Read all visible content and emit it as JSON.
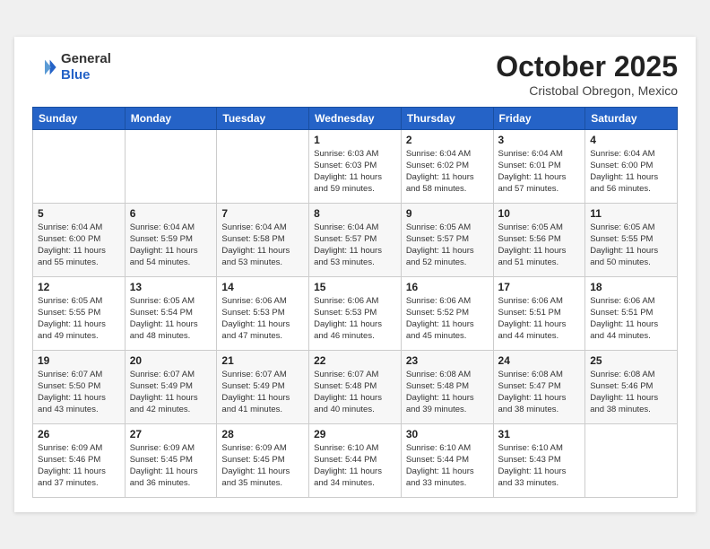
{
  "header": {
    "logo": {
      "general": "General",
      "blue": "Blue"
    },
    "month": "October 2025",
    "location": "Cristobal Obregon, Mexico"
  },
  "weekdays": [
    "Sunday",
    "Monday",
    "Tuesday",
    "Wednesday",
    "Thursday",
    "Friday",
    "Saturday"
  ],
  "weeks": [
    [
      {
        "day": null
      },
      {
        "day": null
      },
      {
        "day": null
      },
      {
        "day": 1,
        "sunrise": "6:03 AM",
        "sunset": "6:03 PM",
        "daylight": "11 hours and 59 minutes."
      },
      {
        "day": 2,
        "sunrise": "6:04 AM",
        "sunset": "6:02 PM",
        "daylight": "11 hours and 58 minutes."
      },
      {
        "day": 3,
        "sunrise": "6:04 AM",
        "sunset": "6:01 PM",
        "daylight": "11 hours and 57 minutes."
      },
      {
        "day": 4,
        "sunrise": "6:04 AM",
        "sunset": "6:00 PM",
        "daylight": "11 hours and 56 minutes."
      }
    ],
    [
      {
        "day": 5,
        "sunrise": "6:04 AM",
        "sunset": "6:00 PM",
        "daylight": "11 hours and 55 minutes."
      },
      {
        "day": 6,
        "sunrise": "6:04 AM",
        "sunset": "5:59 PM",
        "daylight": "11 hours and 54 minutes."
      },
      {
        "day": 7,
        "sunrise": "6:04 AM",
        "sunset": "5:58 PM",
        "daylight": "11 hours and 53 minutes."
      },
      {
        "day": 8,
        "sunrise": "6:04 AM",
        "sunset": "5:57 PM",
        "daylight": "11 hours and 53 minutes."
      },
      {
        "day": 9,
        "sunrise": "6:05 AM",
        "sunset": "5:57 PM",
        "daylight": "11 hours and 52 minutes."
      },
      {
        "day": 10,
        "sunrise": "6:05 AM",
        "sunset": "5:56 PM",
        "daylight": "11 hours and 51 minutes."
      },
      {
        "day": 11,
        "sunrise": "6:05 AM",
        "sunset": "5:55 PM",
        "daylight": "11 hours and 50 minutes."
      }
    ],
    [
      {
        "day": 12,
        "sunrise": "6:05 AM",
        "sunset": "5:55 PM",
        "daylight": "11 hours and 49 minutes."
      },
      {
        "day": 13,
        "sunrise": "6:05 AM",
        "sunset": "5:54 PM",
        "daylight": "11 hours and 48 minutes."
      },
      {
        "day": 14,
        "sunrise": "6:06 AM",
        "sunset": "5:53 PM",
        "daylight": "11 hours and 47 minutes."
      },
      {
        "day": 15,
        "sunrise": "6:06 AM",
        "sunset": "5:53 PM",
        "daylight": "11 hours and 46 minutes."
      },
      {
        "day": 16,
        "sunrise": "6:06 AM",
        "sunset": "5:52 PM",
        "daylight": "11 hours and 45 minutes."
      },
      {
        "day": 17,
        "sunrise": "6:06 AM",
        "sunset": "5:51 PM",
        "daylight": "11 hours and 44 minutes."
      },
      {
        "day": 18,
        "sunrise": "6:06 AM",
        "sunset": "5:51 PM",
        "daylight": "11 hours and 44 minutes."
      }
    ],
    [
      {
        "day": 19,
        "sunrise": "6:07 AM",
        "sunset": "5:50 PM",
        "daylight": "11 hours and 43 minutes."
      },
      {
        "day": 20,
        "sunrise": "6:07 AM",
        "sunset": "5:49 PM",
        "daylight": "11 hours and 42 minutes."
      },
      {
        "day": 21,
        "sunrise": "6:07 AM",
        "sunset": "5:49 PM",
        "daylight": "11 hours and 41 minutes."
      },
      {
        "day": 22,
        "sunrise": "6:07 AM",
        "sunset": "5:48 PM",
        "daylight": "11 hours and 40 minutes."
      },
      {
        "day": 23,
        "sunrise": "6:08 AM",
        "sunset": "5:48 PM",
        "daylight": "11 hours and 39 minutes."
      },
      {
        "day": 24,
        "sunrise": "6:08 AM",
        "sunset": "5:47 PM",
        "daylight": "11 hours and 38 minutes."
      },
      {
        "day": 25,
        "sunrise": "6:08 AM",
        "sunset": "5:46 PM",
        "daylight": "11 hours and 38 minutes."
      }
    ],
    [
      {
        "day": 26,
        "sunrise": "6:09 AM",
        "sunset": "5:46 PM",
        "daylight": "11 hours and 37 minutes."
      },
      {
        "day": 27,
        "sunrise": "6:09 AM",
        "sunset": "5:45 PM",
        "daylight": "11 hours and 36 minutes."
      },
      {
        "day": 28,
        "sunrise": "6:09 AM",
        "sunset": "5:45 PM",
        "daylight": "11 hours and 35 minutes."
      },
      {
        "day": 29,
        "sunrise": "6:10 AM",
        "sunset": "5:44 PM",
        "daylight": "11 hours and 34 minutes."
      },
      {
        "day": 30,
        "sunrise": "6:10 AM",
        "sunset": "5:44 PM",
        "daylight": "11 hours and 33 minutes."
      },
      {
        "day": 31,
        "sunrise": "6:10 AM",
        "sunset": "5:43 PM",
        "daylight": "11 hours and 33 minutes."
      },
      {
        "day": null
      }
    ]
  ]
}
